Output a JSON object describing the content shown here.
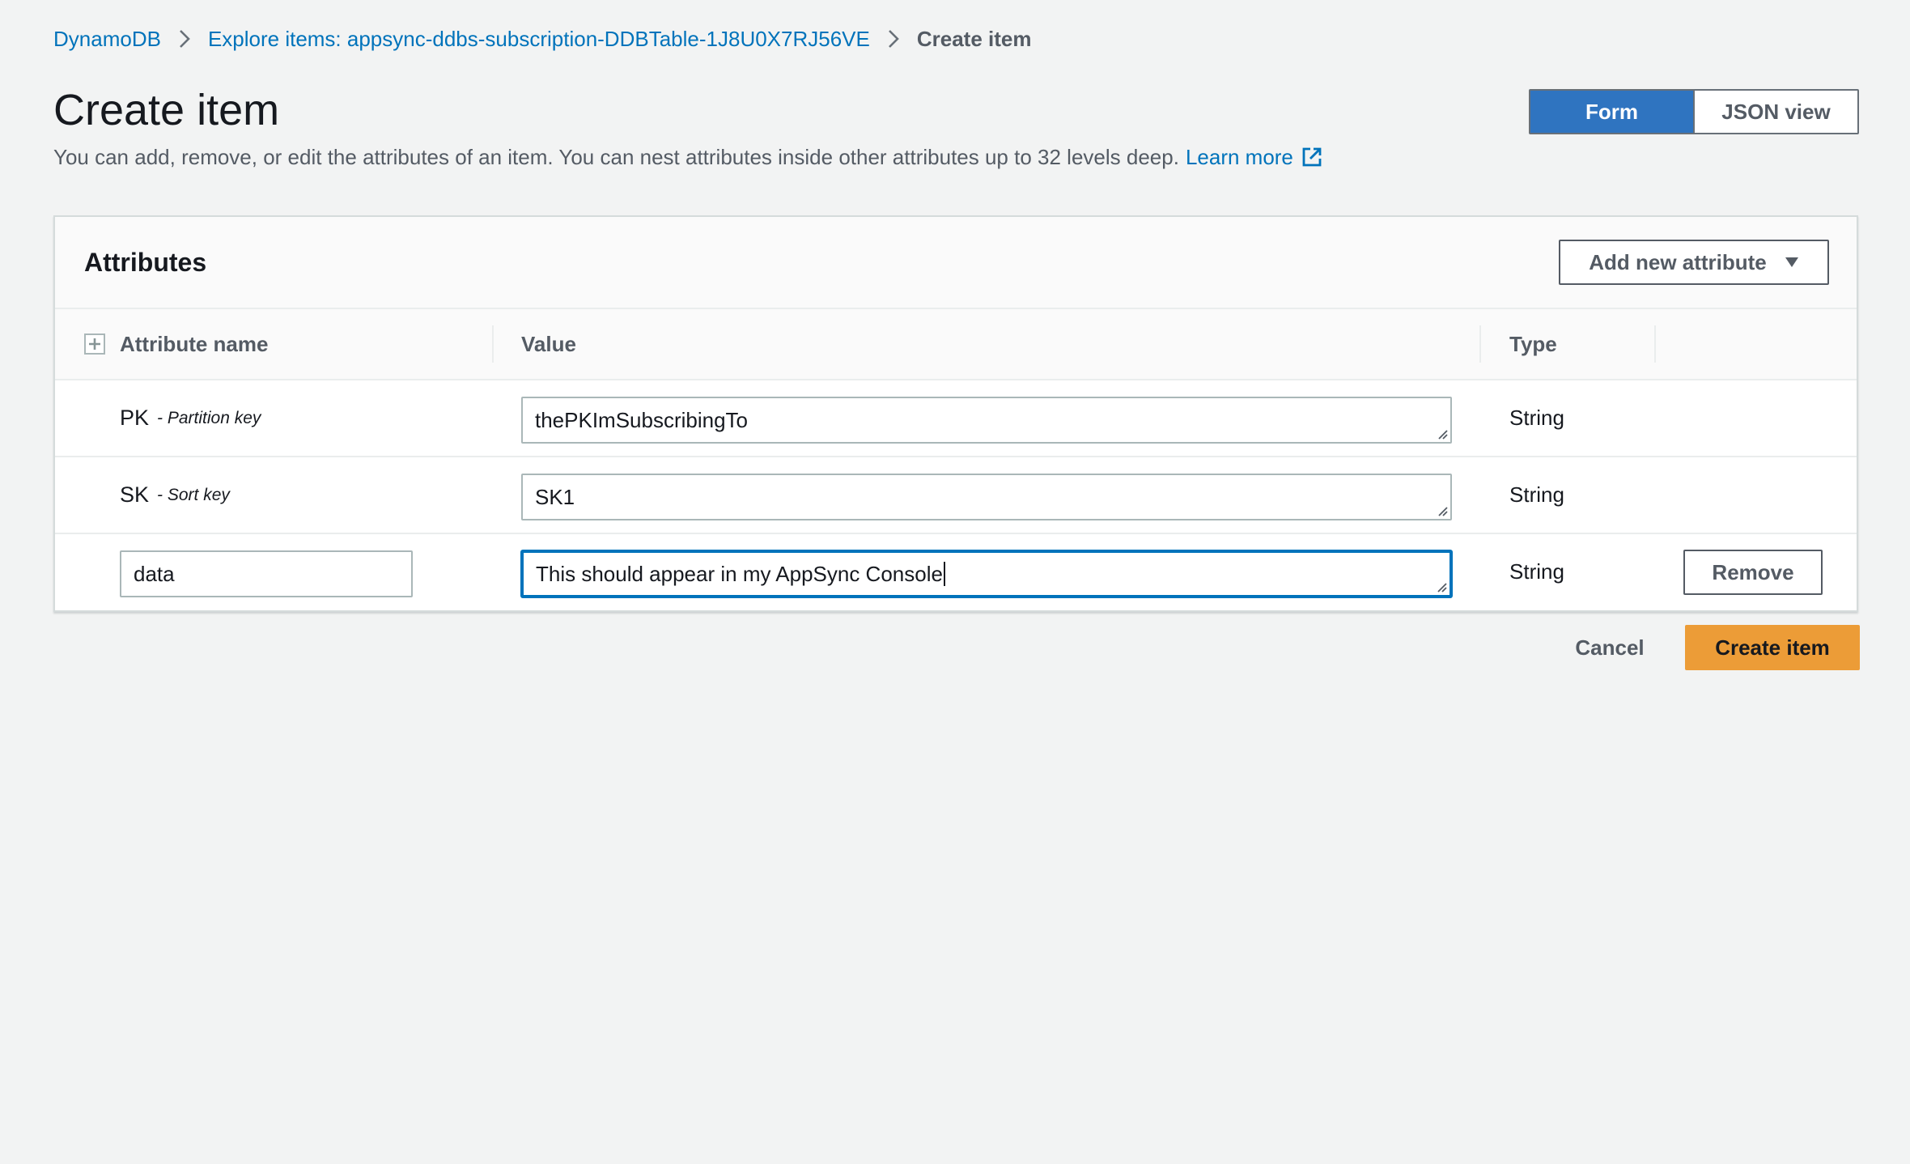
{
  "breadcrumb": {
    "items": [
      {
        "label": "DynamoDB"
      },
      {
        "label": "Explore items: appsync-ddbs-subscription-DDBTable-1J8U0X7RJ56VE"
      }
    ],
    "current": "Create item",
    "separator_icon": "chevron-right-icon"
  },
  "header": {
    "title": "Create item",
    "description": "You can add, remove, or edit the attributes of an item. You can nest attributes inside other attributes up to 32 levels deep.",
    "learn_more": "Learn more",
    "learn_more_icon": "external-link-icon"
  },
  "view_toggle": {
    "options": [
      {
        "label": "Form",
        "selected": true
      },
      {
        "label": "JSON view",
        "selected": false
      }
    ]
  },
  "attributes": {
    "title": "Attributes",
    "add_button": "Add new attribute",
    "columns": {
      "name": "Attribute name",
      "value": "Value",
      "type": "Type"
    },
    "rows": [
      {
        "name": "PK",
        "key_type": "- Partition key",
        "value": "thePKImSubscribingTo",
        "type": "String"
      },
      {
        "name": "SK",
        "key_type": "- Sort key",
        "value": "SK1",
        "type": "String"
      },
      {
        "name": "data",
        "value": "This should appear in my AppSync Console",
        "type": "String",
        "remove": "Remove"
      }
    ]
  },
  "footer": {
    "cancel": "Cancel",
    "create": "Create item"
  },
  "colors": {
    "link": "#0073bb",
    "primary": "#ec9c37",
    "toggle_active": "#2f74c0",
    "background": "#f2f3f3"
  }
}
